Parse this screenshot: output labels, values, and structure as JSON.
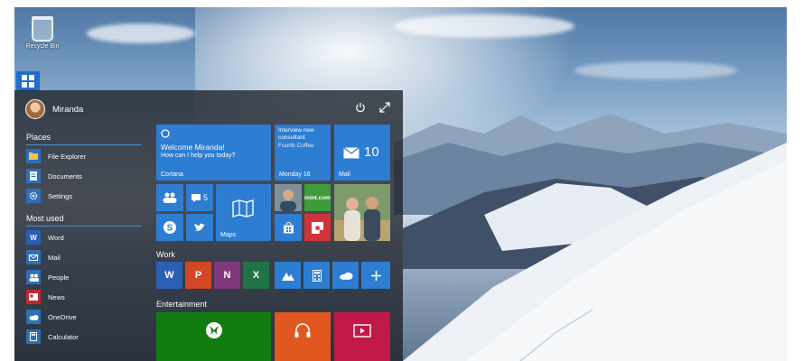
{
  "desktop": {
    "recycle_bin_label": "Recycle Bin"
  },
  "start_menu": {
    "user_name": "Miranda",
    "places": {
      "header": "Places",
      "items": [
        {
          "label": "File Explorer",
          "icon": "folder-icon",
          "color": "#2d6fb8"
        },
        {
          "label": "Documents",
          "icon": "document-icon",
          "color": "#2d6fb8"
        },
        {
          "label": "Settings",
          "icon": "gear-icon",
          "color": "#2d6fb8"
        }
      ]
    },
    "most_used": {
      "header": "Most used",
      "items": [
        {
          "label": "Word",
          "icon": "word-icon",
          "color": "#2b5fb4"
        },
        {
          "label": "Mail",
          "icon": "mail-icon",
          "color": "#2d6fb8"
        },
        {
          "label": "People",
          "icon": "people-icon",
          "color": "#2d6fb8"
        },
        {
          "label": "News",
          "icon": "news-icon",
          "color": "#c1272d"
        },
        {
          "label": "OneDrive",
          "icon": "cloud-icon",
          "color": "#2d6fb8"
        },
        {
          "label": "Calculator",
          "icon": "calculator-icon",
          "color": "#2d6fb8"
        }
      ]
    },
    "tiles": {
      "cortana": {
        "title": "Welcome Miranda!",
        "subtitle": "How can I help you today?",
        "label": "Cortana"
      },
      "calendar": {
        "line1": "Interview new consultant",
        "line2": "Fourth Coffee",
        "label": "Monday 16"
      },
      "mail": {
        "count": "10",
        "label": "Mail"
      },
      "people_count": "5",
      "maps_label": "Maps",
      "mint_text": "mint.com"
    },
    "groups": {
      "work": "Work",
      "entertainment": "Entertainment"
    },
    "accent": "#2d7dd2"
  }
}
